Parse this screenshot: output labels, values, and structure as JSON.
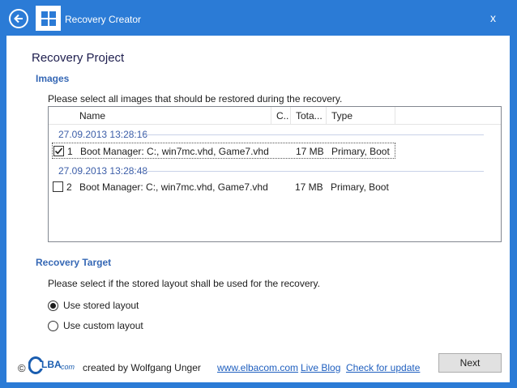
{
  "window": {
    "title": "Recovery Creator",
    "close_glyph": "x"
  },
  "page": {
    "heading": "Recovery Project"
  },
  "images_section": {
    "label": "Images",
    "instruction": "Please select all images that should be restored during the recovery.",
    "columns": [
      "Name",
      "C..",
      "Tota...",
      "Type"
    ],
    "groups": [
      {
        "date": "27.09.2013 13:28:16",
        "item": {
          "checked": true,
          "number": "1",
          "name": "Boot Manager: C:, win7mc.vhd, Game7.vhd",
          "total": "17 MB",
          "type": "Primary, Boot"
        }
      },
      {
        "date": "27.09.2013 13:28:48",
        "item": {
          "checked": false,
          "number": "2",
          "name": "Boot Manager: C:, win7mc.vhd, Game7.vhd",
          "total": "17 MB",
          "type": "Primary, Boot"
        }
      }
    ]
  },
  "target_section": {
    "label": "Recovery Target",
    "instruction": "Please select if the stored layout shall be used for the recovery.",
    "options": [
      {
        "label": "Use stored layout",
        "selected": true
      },
      {
        "label": "Use custom layout",
        "selected": false
      }
    ]
  },
  "footer": {
    "copyright": "©",
    "logo_text": "LBA",
    "logo_suffix": "com",
    "credit": "created by Wolfgang Unger",
    "links": [
      "www.elbacom.com",
      "Live Blog",
      "Check for update"
    ],
    "next_label": "Next"
  },
  "colors": {
    "accent": "#2b7bd6",
    "section": "#3668b5",
    "link": "#1f5fbf",
    "logo_blue": "#1a5db0"
  },
  "icons": {
    "back": "back-arrow-icon",
    "app": "windows-logo-icon",
    "close": "close-icon"
  }
}
